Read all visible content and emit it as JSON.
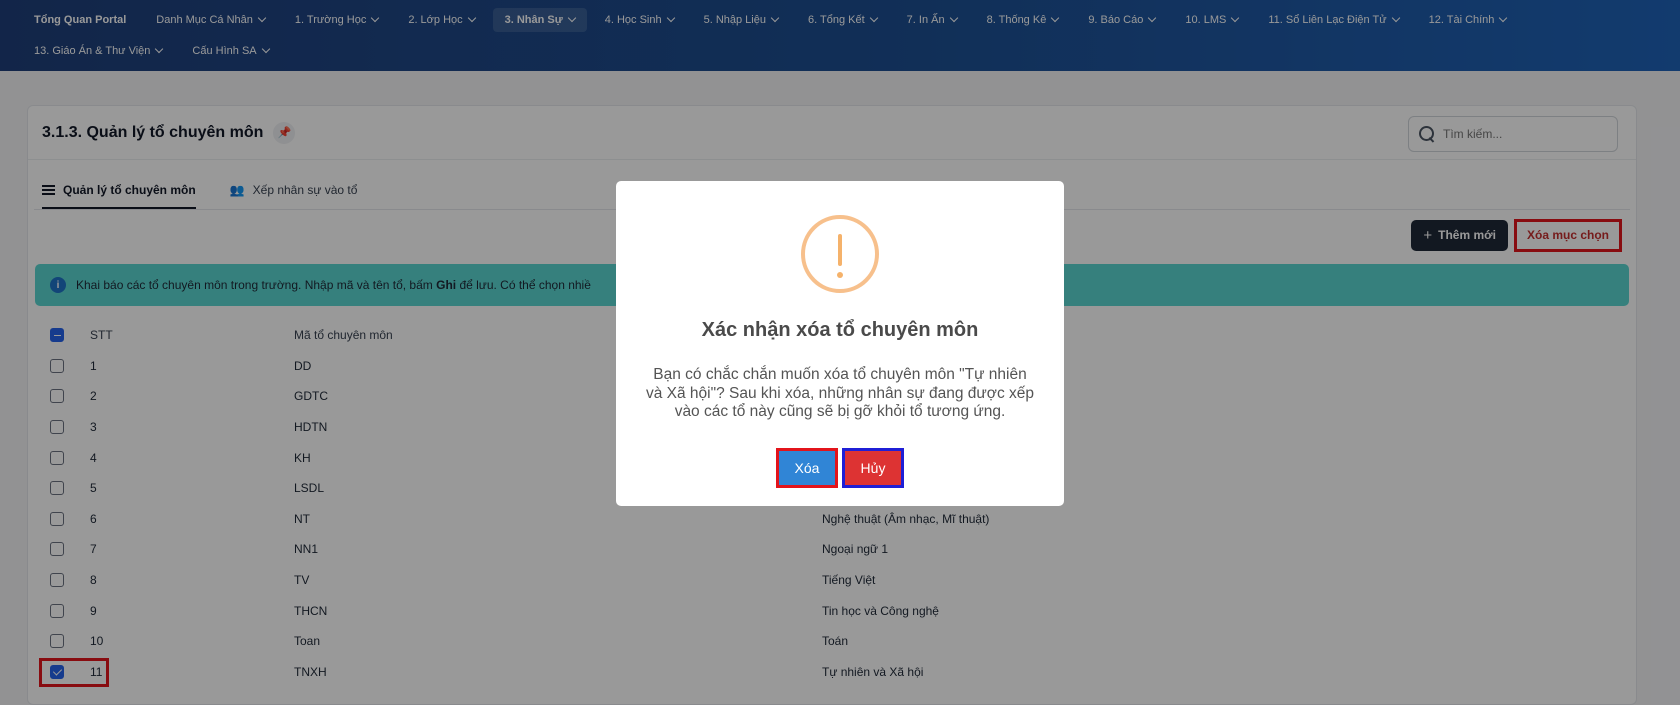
{
  "nav": {
    "row1": [
      {
        "label": "Tổng Quan Portal",
        "has_chevron": false
      },
      {
        "label": "Danh Mục Cá Nhân",
        "has_chevron": true
      },
      {
        "label": "1. Trường Học",
        "has_chevron": true
      },
      {
        "label": "2. Lớp Học",
        "has_chevron": true
      },
      {
        "label": "3. Nhân Sự",
        "has_chevron": true,
        "active": true
      },
      {
        "label": "4. Học Sinh",
        "has_chevron": true
      },
      {
        "label": "5. Nhập Liệu",
        "has_chevron": true
      },
      {
        "label": "6. Tổng Kết",
        "has_chevron": true
      },
      {
        "label": "7. In Ấn",
        "has_chevron": true
      },
      {
        "label": "8. Thống Kê",
        "has_chevron": true
      },
      {
        "label": "9. Báo Cáo",
        "has_chevron": true
      },
      {
        "label": "10. LMS",
        "has_chevron": true
      },
      {
        "label": "11. Sổ Liên Lạc Điện Tử",
        "has_chevron": true
      },
      {
        "label": "12. Tài Chính",
        "has_chevron": true
      }
    ],
    "row2": [
      {
        "label": "13. Giáo Án & Thư Viện",
        "has_chevron": true
      },
      {
        "label": "Cấu Hình SA",
        "has_chevron": true
      }
    ]
  },
  "page": {
    "title": "3.1.3. Quản lý tổ chuyên môn",
    "pin_icon": "pin-icon",
    "search_placeholder": "Tìm kiếm..."
  },
  "tabs": [
    {
      "label": "Quản lý tổ chuyên môn",
      "icon": "list-icon",
      "active": true
    },
    {
      "label": "Xếp nhân sự vào tổ",
      "icon": "users-icon",
      "active": false
    }
  ],
  "toolbar": {
    "add_label": "Thêm mới",
    "delete_selected_label": "Xóa mục chọn"
  },
  "info": {
    "text_before": "Khai báo các tổ chuyên môn trong trường. Nhập mã và tên tổ, bấm ",
    "text_bold": "Ghi",
    "text_after": " để lưu. Có thể chọn nhiề"
  },
  "table": {
    "headers": {
      "stt": "STT",
      "ma": "Mã tổ chuyên môn",
      "ten": ""
    },
    "rows": [
      {
        "stt": "1",
        "ma": "DD",
        "ten": "",
        "checked": false
      },
      {
        "stt": "2",
        "ma": "GDTC",
        "ten": "",
        "checked": false
      },
      {
        "stt": "3",
        "ma": "HDTN",
        "ten": "",
        "checked": false
      },
      {
        "stt": "4",
        "ma": "KH",
        "ten": "",
        "checked": false
      },
      {
        "stt": "5",
        "ma": "LSDL",
        "ten": "",
        "checked": false
      },
      {
        "stt": "6",
        "ma": "NT",
        "ten": "Nghệ thuật (Âm nhạc, Mĩ thuật)",
        "checked": false
      },
      {
        "stt": "7",
        "ma": "NN1",
        "ten": "Ngoại ngữ 1",
        "checked": false
      },
      {
        "stt": "8",
        "ma": "TV",
        "ten": "Tiếng Việt",
        "checked": false
      },
      {
        "stt": "9",
        "ma": "THCN",
        "ten": "Tin học và Công nghệ",
        "checked": false
      },
      {
        "stt": "10",
        "ma": "Toan",
        "ten": "Toán",
        "checked": false
      },
      {
        "stt": "11",
        "ma": "TNXH",
        "ten": "Tự nhiên và Xã hội",
        "checked": true
      }
    ]
  },
  "modal": {
    "icon": "warning-icon",
    "title": "Xác nhận xóa tổ chuyên môn",
    "message": "Bạn có chắc chắn muốn xóa tổ chuyên môn \"Tự nhiên và Xã hội\"? Sau khi xóa, những nhân sự đang được xếp vào các tổ này cũng sẽ bị gỡ khỏi tổ tương ứng.",
    "confirm_label": "Xóa",
    "cancel_label": "Hủy"
  },
  "colors": {
    "nav_gradient_start": "#1e3f7a",
    "nav_gradient_end": "#1f63b8",
    "info_bg": "#5bd6d0",
    "confirm_btn": "#3085d6",
    "cancel_btn": "#dd3333",
    "highlight_red": "#e3141b",
    "highlight_blue": "#1f1fd6"
  }
}
